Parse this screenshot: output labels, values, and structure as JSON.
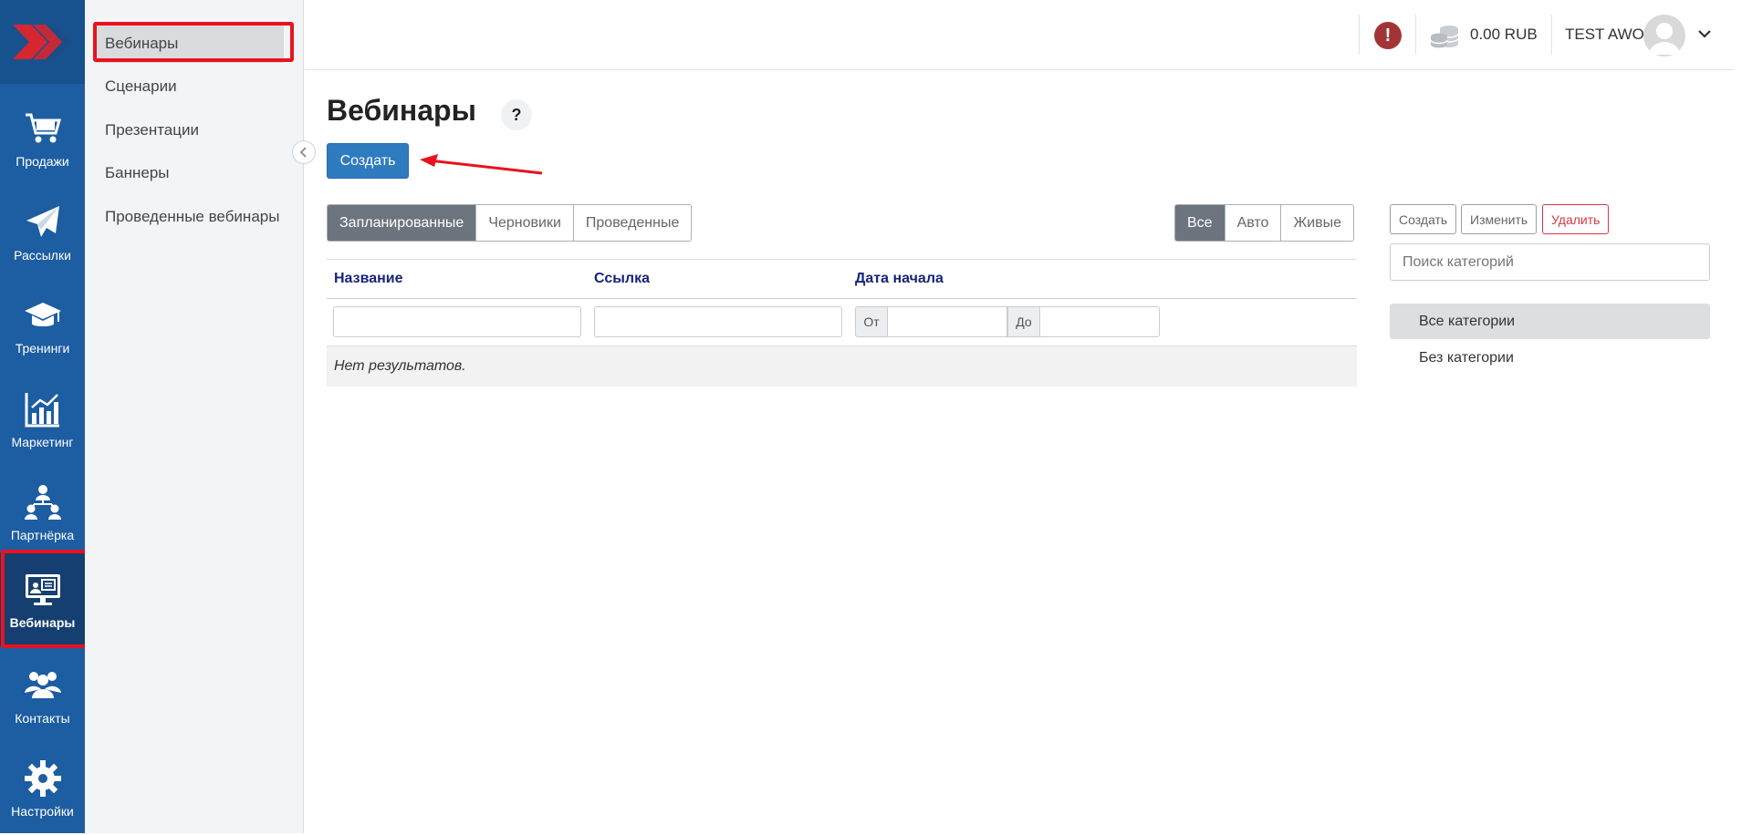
{
  "rail": {
    "items": [
      {
        "label": "Продажи",
        "icon": "cart-icon"
      },
      {
        "label": "Рассылки",
        "icon": "paper-plane-icon"
      },
      {
        "label": "Тренинги",
        "icon": "graduation-cap-icon"
      },
      {
        "label": "Маркетинг",
        "icon": "bar-chart-icon"
      },
      {
        "label": "Партнёрка",
        "icon": "network-icon"
      },
      {
        "label": "Вебинары",
        "icon": "webinar-monitor-icon"
      },
      {
        "label": "Контакты",
        "icon": "users-icon"
      },
      {
        "label": "Настройки",
        "icon": "gear-icon"
      }
    ]
  },
  "submenu": {
    "items": [
      "Вебинары",
      "Сценарии",
      "Презентации",
      "Баннеры",
      "Проведенные вебинары"
    ]
  },
  "topbar": {
    "balance": "0.00 RUB",
    "user": "TEST AWO"
  },
  "main": {
    "title": "Вебинары",
    "help": "?",
    "create_label": "Создать",
    "status_tabs": [
      "Запланированные",
      "Черновики",
      "Проведенные"
    ],
    "type_tabs": [
      "Все",
      "Авто",
      "Живые"
    ],
    "columns": [
      "Название",
      "Ссылка",
      "Дата начала"
    ],
    "date_from": "От",
    "date_to": "До",
    "empty": "Нет результатов."
  },
  "categories": {
    "create": "Создать",
    "edit": "Изменить",
    "delete": "Удалить",
    "search_placeholder": "Поиск категорий",
    "items": [
      "Все категории",
      "Без категории"
    ]
  },
  "colors": {
    "rail": "#1d5da1",
    "primary": "#2f7bbf",
    "highlight": "#e8131f"
  }
}
